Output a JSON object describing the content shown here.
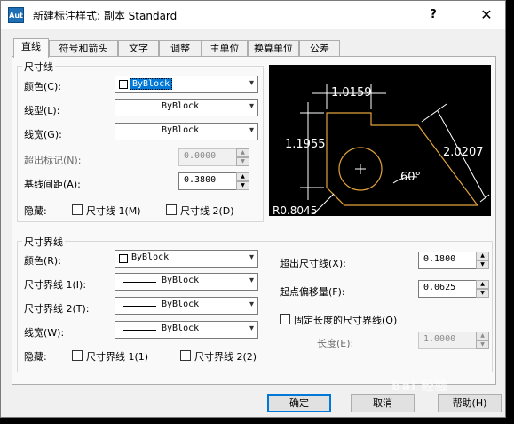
{
  "window": {
    "title": "新建标注样式: 副本 Standard",
    "icon_text": "Aut",
    "help_icon": "?",
    "close_icon": "✕"
  },
  "tabs": [
    {
      "label": "直线",
      "active": true
    },
    {
      "label": "符号和箭头"
    },
    {
      "label": "文字"
    },
    {
      "label": "调整"
    },
    {
      "label": "主单位"
    },
    {
      "label": "换算单位"
    },
    {
      "label": "公差"
    }
  ],
  "dim_lines": {
    "title": "尺寸线",
    "color_label": "颜色(C):",
    "color_value": "ByBlock",
    "linetype_label": "线型(L):",
    "linetype_value": "ByBlock",
    "lineweight_label": "线宽(G):",
    "lineweight_value": "ByBlock",
    "extend_label": "超出标记(N):",
    "extend_value": "0.0000",
    "baseline_label": "基线间距(A):",
    "baseline_value": "0.3800",
    "suppress_label": "隐藏:",
    "suppress1_label": "尺寸线 1(M)",
    "suppress2_label": "尺寸线 2(D)"
  },
  "ext_lines": {
    "title": "尺寸界线",
    "color_label": "颜色(R):",
    "color_value": "ByBlock",
    "lt1_label": "尺寸界线 1(I):",
    "lt1_value": "ByBlock",
    "lt2_label": "尺寸界线 2(T):",
    "lt2_value": "ByBlock",
    "lineweight_label": "线宽(W):",
    "lineweight_value": "ByBlock",
    "suppress_label": "隐藏:",
    "suppress1_label": "尺寸界线 1(1)",
    "suppress2_label": "尺寸界线 2(2)",
    "beyond_label": "超出尺寸线(X):",
    "beyond_value": "0.1800",
    "offset_label": "起点偏移量(F):",
    "offset_value": "0.0625",
    "fixed_label": "固定长度的尺寸界线(O)",
    "length_label": "长度(E):",
    "length_value": "1.0000"
  },
  "preview": {
    "dim_top": "1.0159",
    "dim_left": "1.1955",
    "dim_right": "2.0207",
    "angle": "60°",
    "radius": "R0.8045",
    "colors": {
      "shape": "#e3a33c",
      "dims": "#ffffff",
      "bg": "#000000"
    }
  },
  "buttons": {
    "ok": "确定",
    "cancel": "取消",
    "help": "帮助(H)"
  },
  "watermark": "Bai 经验"
}
